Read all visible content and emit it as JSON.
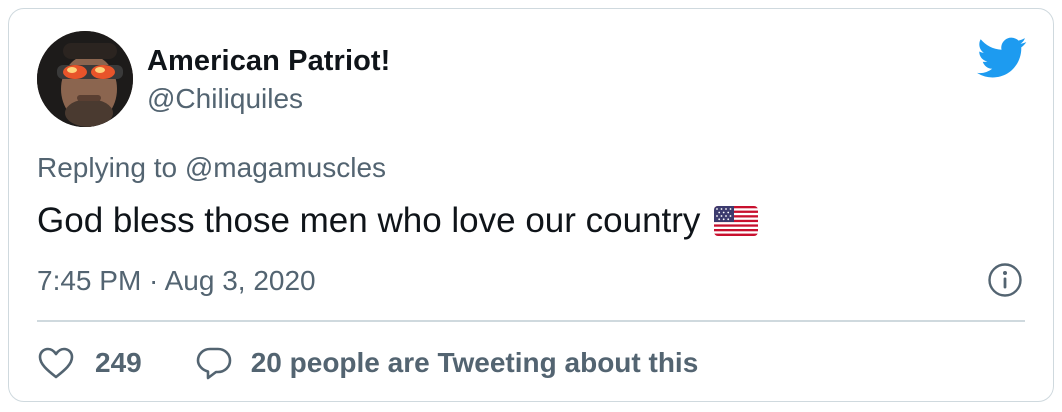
{
  "author": {
    "display_name": "American Patriot!",
    "handle": "@Chiliquiles"
  },
  "icons": {
    "brand": "twitter-bird-icon",
    "info": "info-icon",
    "like": "heart-icon",
    "reply": "speech-bubble-icon",
    "flag": "us-flag-emoji"
  },
  "tweet": {
    "replying_prefix": "Replying to",
    "replying_mention": "@magamuscles",
    "text": "God bless those men who love our country",
    "timestamp": "7:45 PM · Aug 3, 2020"
  },
  "actions": {
    "like_count": "249",
    "reply_label": "20 people are Tweeting about this"
  },
  "colors": {
    "brand": "#1d9bf0",
    "text_primary": "#0f1419",
    "text_secondary": "#536471",
    "border": "#cfd9de"
  }
}
